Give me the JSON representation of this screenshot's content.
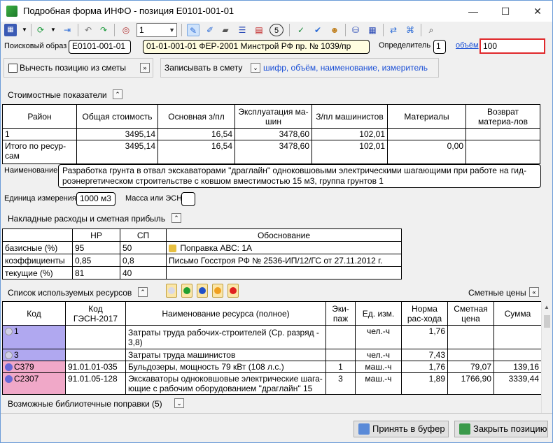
{
  "window": {
    "title": "Подробная форма ИНФО - позиция Е0101-001-01",
    "minimize": "—",
    "maximize": "☐",
    "close": "✕"
  },
  "toolbar": {
    "select_value": "1",
    "icons": [
      "grid-icon",
      "refresh-icon",
      "pin-icon",
      "undo-icon",
      "redo-icon",
      "globe-icon",
      "pencil-icon",
      "edit-icon",
      "comment-icon",
      "list-icon",
      "book-icon",
      "five-icon",
      "calc-icon",
      "check-icon",
      "person-icon",
      "db-icon",
      "table-icon",
      "swap-icon",
      "tree-icon",
      "search-icon"
    ],
    "five_label": "5"
  },
  "search": {
    "label": "Поисковый образ",
    "code": "Е0101-001-01",
    "source": "01-01-001-01 ФЕР-2001 Минстрой РФ пр. № 1039/пр",
    "determinant_label": "Определитель",
    "determinant_value": "1",
    "volume_link": "объём",
    "volume_value": "100"
  },
  "subtract": {
    "label": "Вычесть позицию из сметы",
    "btn": "»"
  },
  "write": {
    "label": "Записывать в смету",
    "value": "шифр, объём, наименование, измеритель"
  },
  "cost": {
    "title": "Стоимостные показатели",
    "headers": [
      "Район",
      "Общая стоимость",
      "Основная з/пл",
      "Эксплуатация ма-шин",
      "З/пл машинистов",
      "Материалы",
      "Возврат материа-лов"
    ],
    "rows": [
      [
        "1",
        "3495,14",
        "16,54",
        "3478,60",
        "102,01",
        "",
        ""
      ],
      [
        "Итого по ресур-сам",
        "3495,14",
        "16,54",
        "3478,60",
        "102,01",
        "0,00",
        ""
      ]
    ]
  },
  "name": {
    "label": "Наименование",
    "value": "Разработка грунта в отвал экскаваторами \"драглайн\" одноковшовыми электрическими шагающими при работе на гид-роэнергетическом строительстве с ковшом вместимостью 15 м3, группа грунтов 1"
  },
  "unit": {
    "label": "Единица измерения",
    "value": "1000 м3",
    "mass_label": "Масса или ЭСН",
    "mass_value": ""
  },
  "overhead": {
    "title": "Накладные расходы и сметная прибыль",
    "headers": [
      "",
      "НР",
      "СП",
      "Обоснование"
    ],
    "rows": [
      [
        "базисные (%)",
        "95",
        "50",
        "Поправка АВС: 1А"
      ],
      [
        "коэффициенты",
        "0,85",
        "0,8",
        "Письмо Госстроя РФ № 2536-ИП/12/ГС от 27.11.2012 г."
      ],
      [
        "текущие (%)",
        "81",
        "40",
        ""
      ]
    ]
  },
  "resources": {
    "title": "Список используемых ресурсов",
    "prices_label": "Сметные цены",
    "headers": [
      "Код",
      "Код ГЭСН-2017",
      "Наименование ресурса (полное)",
      "Эки-паж",
      "Ед. изм.",
      "Норма рас-хода",
      "Сметная цена",
      "Сумма"
    ],
    "rows": [
      {
        "code": "1",
        "gesn": "",
        "name": "Затраты труда рабочих-строителей (Ср. разряд - 3,8)",
        "crew": "",
        "unit": "чел.-ч",
        "norm": "1,76",
        "price": "",
        "sum": ""
      },
      {
        "code": "3",
        "gesn": "",
        "name": "Затраты труда машинистов",
        "crew": "",
        "unit": "чел.-ч",
        "norm": "7,43",
        "price": "",
        "sum": ""
      },
      {
        "code": "С379",
        "gesn": "91.01.01-035",
        "name": "Бульдозеры, мощность 79 кВт (108 л.с.)",
        "crew": "1",
        "unit": "маш.-ч",
        "norm": "1,76",
        "price": "79,07",
        "sum": "139,16"
      },
      {
        "code": "С2307",
        "gesn": "91.01.05-128",
        "name": "Экскаваторы одноковшовые электрические шага-ющие с рабочим оборудованием \"драглайн\" 15",
        "crew": "3",
        "unit": "маш.-ч",
        "norm": "1,89",
        "price": "1766,90",
        "sum": "3339,44"
      }
    ]
  },
  "library": {
    "label": "Возможные библиотечные поправки (5)"
  },
  "buttons": {
    "accept": "Принять в буфер",
    "close": "Закрыть позицию"
  }
}
